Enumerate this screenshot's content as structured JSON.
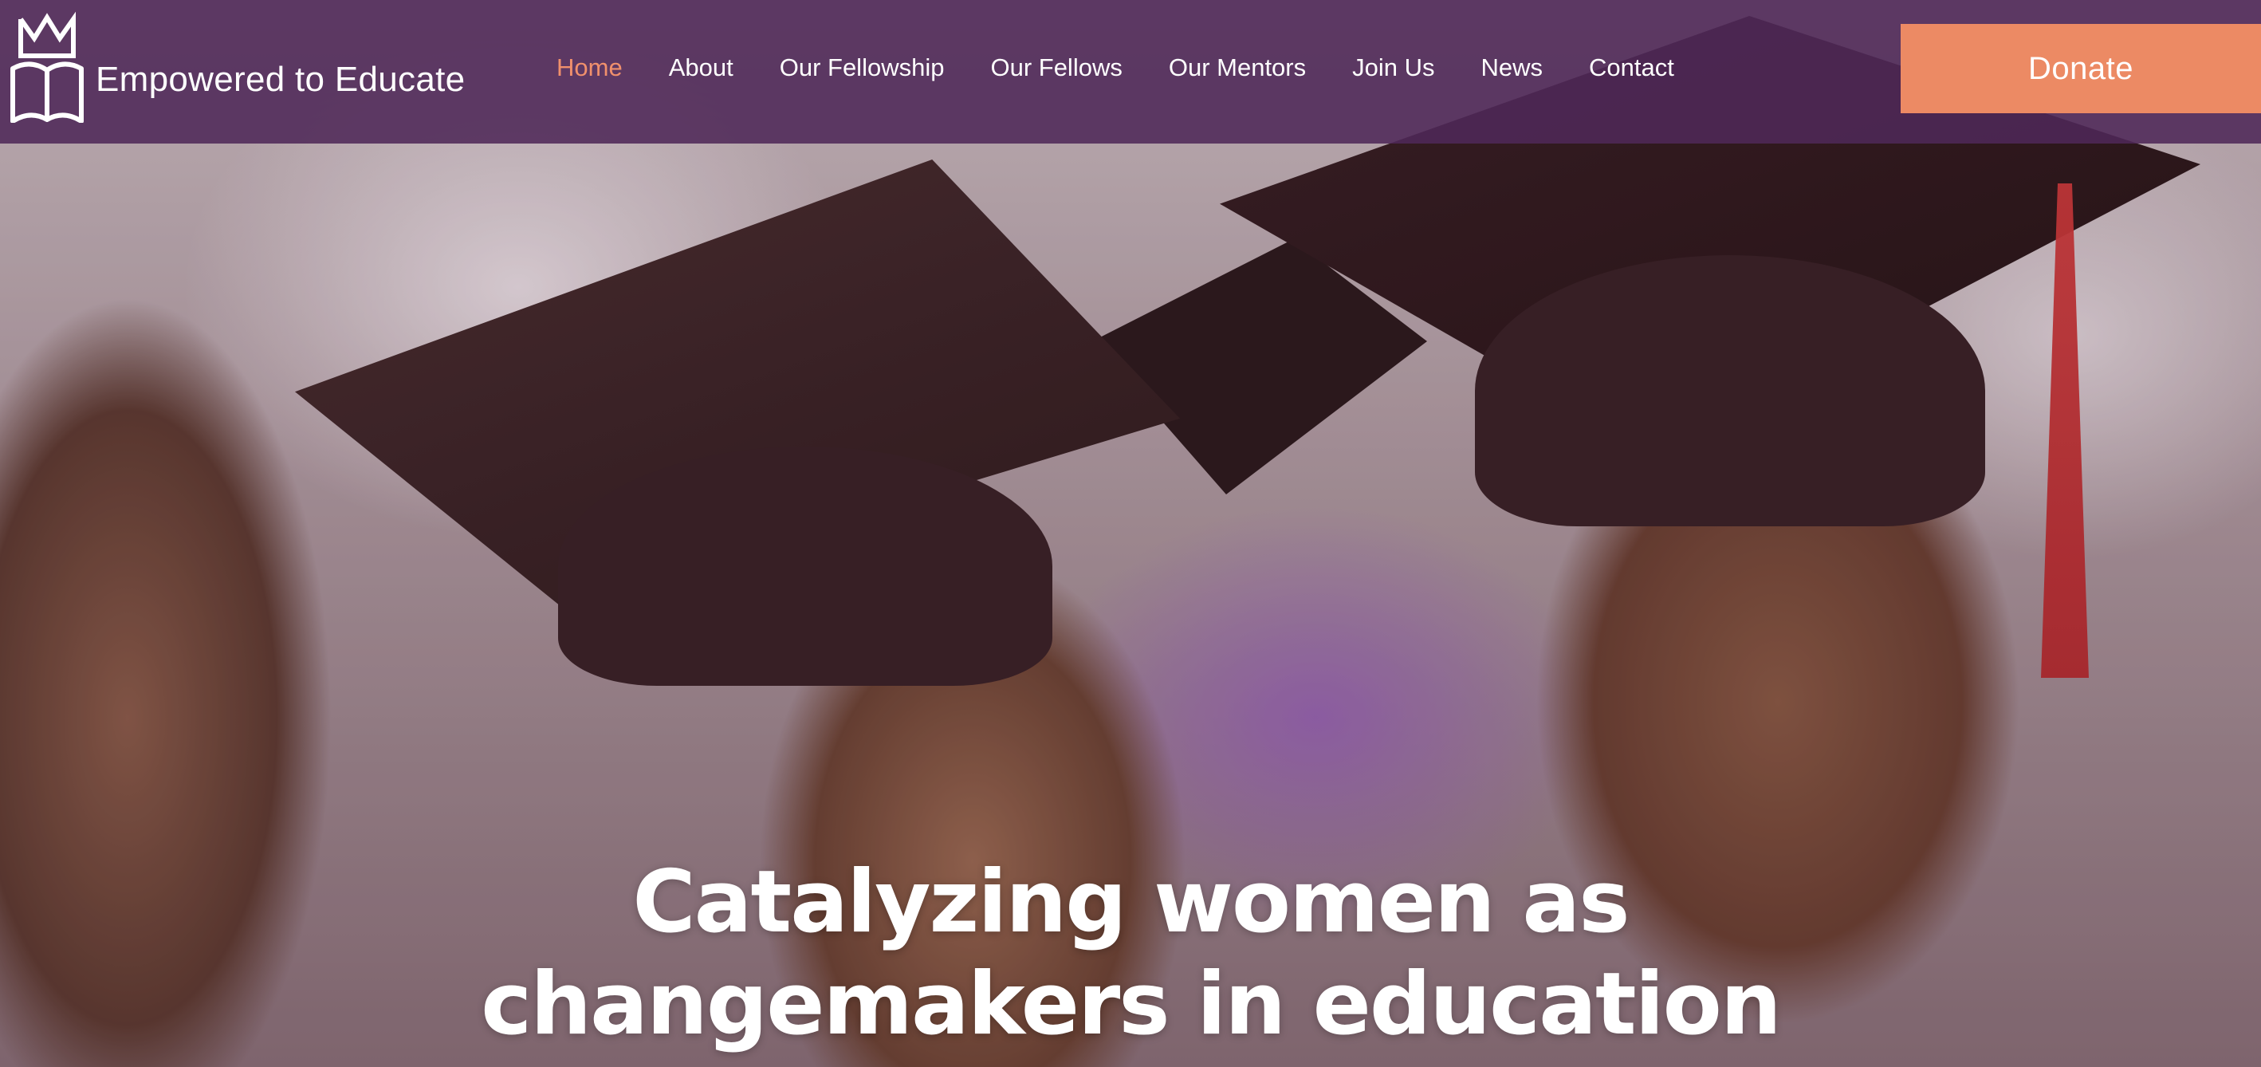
{
  "brand": {
    "name": "Empowered to Educate",
    "logo_icon": "crown-book-icon"
  },
  "nav": {
    "items": [
      {
        "label": "Home",
        "active": true
      },
      {
        "label": "About",
        "active": false
      },
      {
        "label": "Our Fellowship",
        "active": false
      },
      {
        "label": "Our Fellows",
        "active": false
      },
      {
        "label": "Our Mentors",
        "active": false
      },
      {
        "label": "Join Us",
        "active": false
      },
      {
        "label": "News",
        "active": false
      },
      {
        "label": "Contact",
        "active": false
      }
    ]
  },
  "donate": {
    "label": "Donate"
  },
  "hero": {
    "headline_line1": "Catalyzing women as",
    "headline_line2": "changemakers in education",
    "image": "graduates-in-caps-photo"
  },
  "colors": {
    "header_bg": "#4e2858",
    "active_nav": "#f0906c",
    "donate_bg": "#ec8a64",
    "text": "#ffffff"
  }
}
